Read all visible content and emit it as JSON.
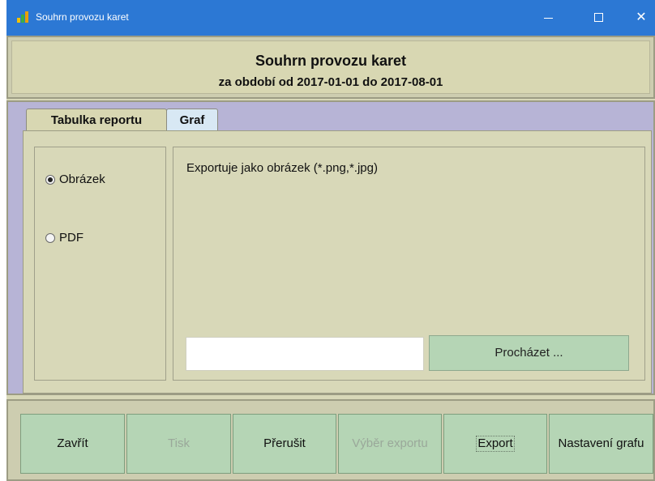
{
  "window": {
    "title": "Souhrn provozu karet",
    "controls": {
      "minimize": "–",
      "close": "✕"
    }
  },
  "header": {
    "title": "Souhrn provozu karet",
    "period": "za období od 2017-01-01 do 2017-08-01"
  },
  "tabs": [
    {
      "label": "Tabulka reportu",
      "selected": false
    },
    {
      "label": "Graf",
      "selected": true
    }
  ],
  "export_options": {
    "formats": [
      {
        "label": "Obrázek",
        "selected": true
      },
      {
        "label": "PDF",
        "selected": false
      }
    ],
    "description": "Exportuje jako obrázek (*.png,*.jpg)",
    "path_value": "",
    "browse_label": "Procházet ..."
  },
  "buttons": {
    "close": "Zavřít",
    "print": "Tisk",
    "interrupt": "Přerušit",
    "export_choice": "Výběr exportu",
    "export": "Export",
    "chart_settings": "Nastavení grafu"
  },
  "colors": {
    "titlebar": "#2c78d4",
    "panel": "#d8d8b8",
    "tabs_background": "#b7b4d6",
    "button": "#b5d5b5"
  }
}
